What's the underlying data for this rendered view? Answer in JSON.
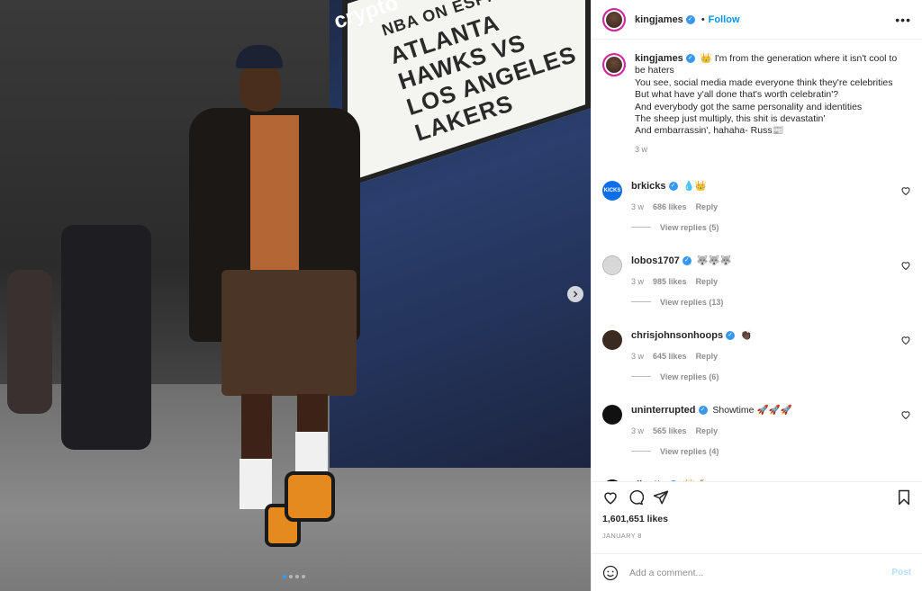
{
  "post": {
    "author": "kingjames",
    "follow_label": "Follow",
    "more_icon": "more-options-icon",
    "verified_icon": "verified-badge-icon",
    "caption": {
      "lines": [
        "👑 I'm from the generation where it isn't cool to be haters",
        "You see, social media made everyone think they're celebrities",
        "But what have y'all done that's worth celebratin'?",
        "And everybody got the same personality and identities",
        "The sheep just multiply, this shit is devastatin'",
        "And embarrassin', hahaha- Russ📰"
      ],
      "time": "3 w"
    },
    "image": {
      "marquee_lines": [
        "NBA ON ESPN",
        "ATLANTA HAWKS VS",
        "LOS ANGELES LAKERS"
      ],
      "sign_text": "crypto",
      "carousel_dots": 4,
      "active_dot": 0
    },
    "comments": [
      {
        "user": "brkicks",
        "text": "💧👑",
        "time": "3 w",
        "likes": "686 likes",
        "reply": "Reply",
        "view_replies": "View replies (5)",
        "avatar_color": "#0c6ee8",
        "avatar_text": "KICKS"
      },
      {
        "user": "lobos1707",
        "text": "🐺🐺🐺",
        "time": "3 w",
        "likes": "985 likes",
        "reply": "Reply",
        "view_replies": "View replies (13)",
        "avatar_color": "#d8d8d8",
        "avatar_text": ""
      },
      {
        "user": "chrisjohnsonhoops",
        "text": "👏🏿",
        "time": "3 w",
        "likes": "645 likes",
        "reply": "Reply",
        "view_replies": "View replies (6)",
        "avatar_color": "#3a2a20",
        "avatar_text": ""
      },
      {
        "user": "uninterrupted",
        "text": "Showtime 🚀🚀🚀",
        "time": "3 w",
        "likes": "565 likes",
        "reply": "Reply",
        "view_replies": "View replies (4)",
        "avatar_color": "#111111",
        "avatar_text": ""
      },
      {
        "user": "eliantte",
        "text": "👑 🐐",
        "time": "",
        "likes": "",
        "reply": "",
        "view_replies": "",
        "avatar_color": "#111111",
        "avatar_text": ""
      }
    ],
    "likes": "1,601,651 likes",
    "date": "JANUARY 8",
    "add_comment": {
      "placeholder": "Add a comment...",
      "post_label": "Post"
    }
  }
}
